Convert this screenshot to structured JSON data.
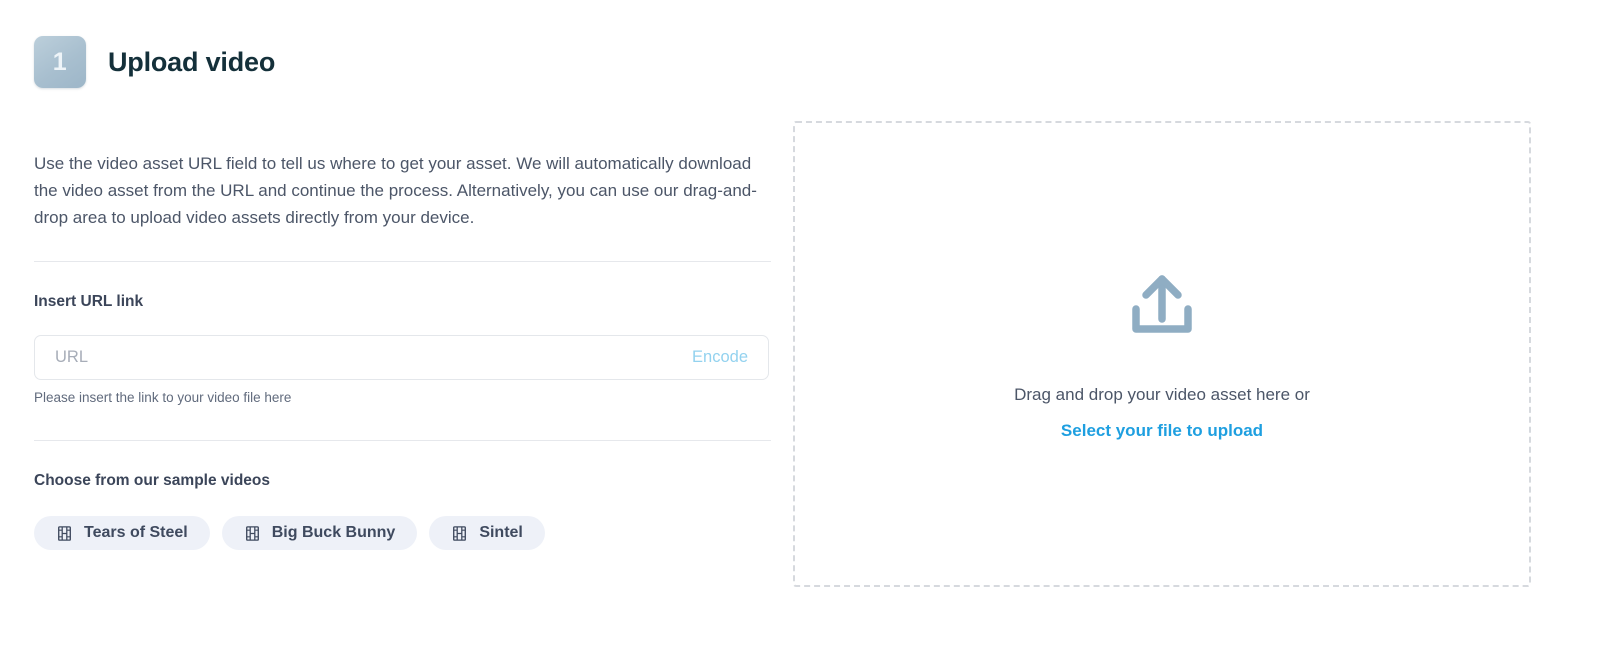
{
  "header": {
    "step_number": "1",
    "title": "Upload video"
  },
  "intro": {
    "text": "Use the video asset URL field to tell us where to get your asset. We will automatically download the video asset from the URL and continue the process. Alternatively, you can use our drag-and-drop area to upload video assets directly from your device."
  },
  "url_section": {
    "label": "Insert URL link",
    "input_value": "",
    "input_placeholder": "URL",
    "encode_label": "Encode",
    "help_text": "Please insert the link to your video file here"
  },
  "samples": {
    "label": "Choose from our sample videos",
    "chips": [
      {
        "label": "Tears of Steel",
        "icon": "film-strip-icon"
      },
      {
        "label": "Big Buck Bunny",
        "icon": "film-strip-icon"
      },
      {
        "label": "Sintel",
        "icon": "film-strip-icon"
      }
    ]
  },
  "dropzone": {
    "icon": "upload-tray-icon",
    "text": "Drag and drop your video asset here or",
    "link_label": "Select your file to upload"
  },
  "colors": {
    "page_title": "#14303a",
    "body_text": "#4c5668",
    "label_text": "#3b4559",
    "encode_link": "#93d2ef",
    "dropzone_link": "#1e9fe0",
    "chip_bg": "#eef1f8",
    "divider": "#e6e8ec",
    "dropzone_border": "#d6d9de",
    "upload_icon": "#8fadc3",
    "badge_gradient_from": "#bccfdb",
    "badge_gradient_to": "#9db6c8"
  }
}
